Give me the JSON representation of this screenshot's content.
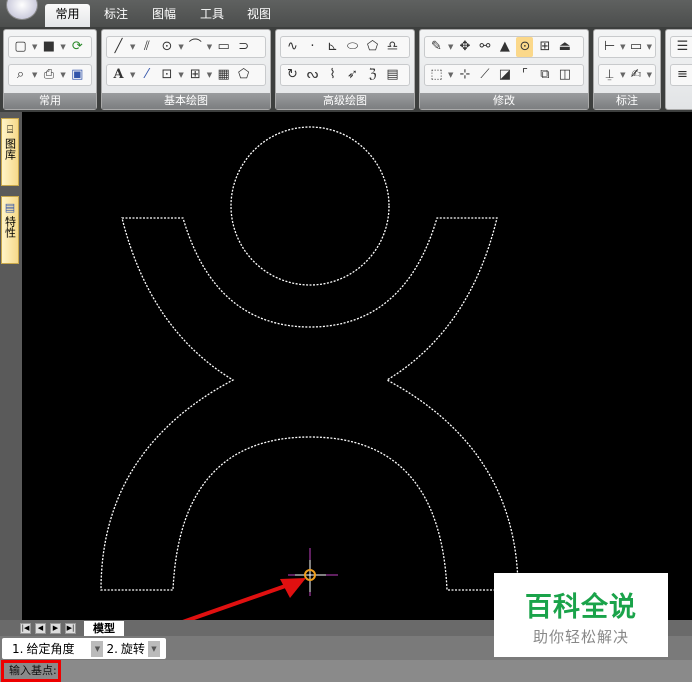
{
  "menu_tabs": [
    "常用",
    "标注",
    "图幅",
    "工具",
    "视图"
  ],
  "ribbon_groups": [
    "常用",
    "基本绘图",
    "高级绘图",
    "修改",
    "标注"
  ],
  "side_tabs": [
    "图库",
    "特性"
  ],
  "model_tab": "模型",
  "command": {
    "option1": "1.",
    "option1_label": "给定角度",
    "option2": "2.",
    "option2_label": "旋转"
  },
  "status_prompt": "输入基点:",
  "watermark": {
    "title": "百科全说",
    "subtitle": "助你轻松解决"
  },
  "colors": {
    "canvas": "#000000",
    "annotation": "#e01010",
    "watermark_green": "#1aa34a"
  }
}
